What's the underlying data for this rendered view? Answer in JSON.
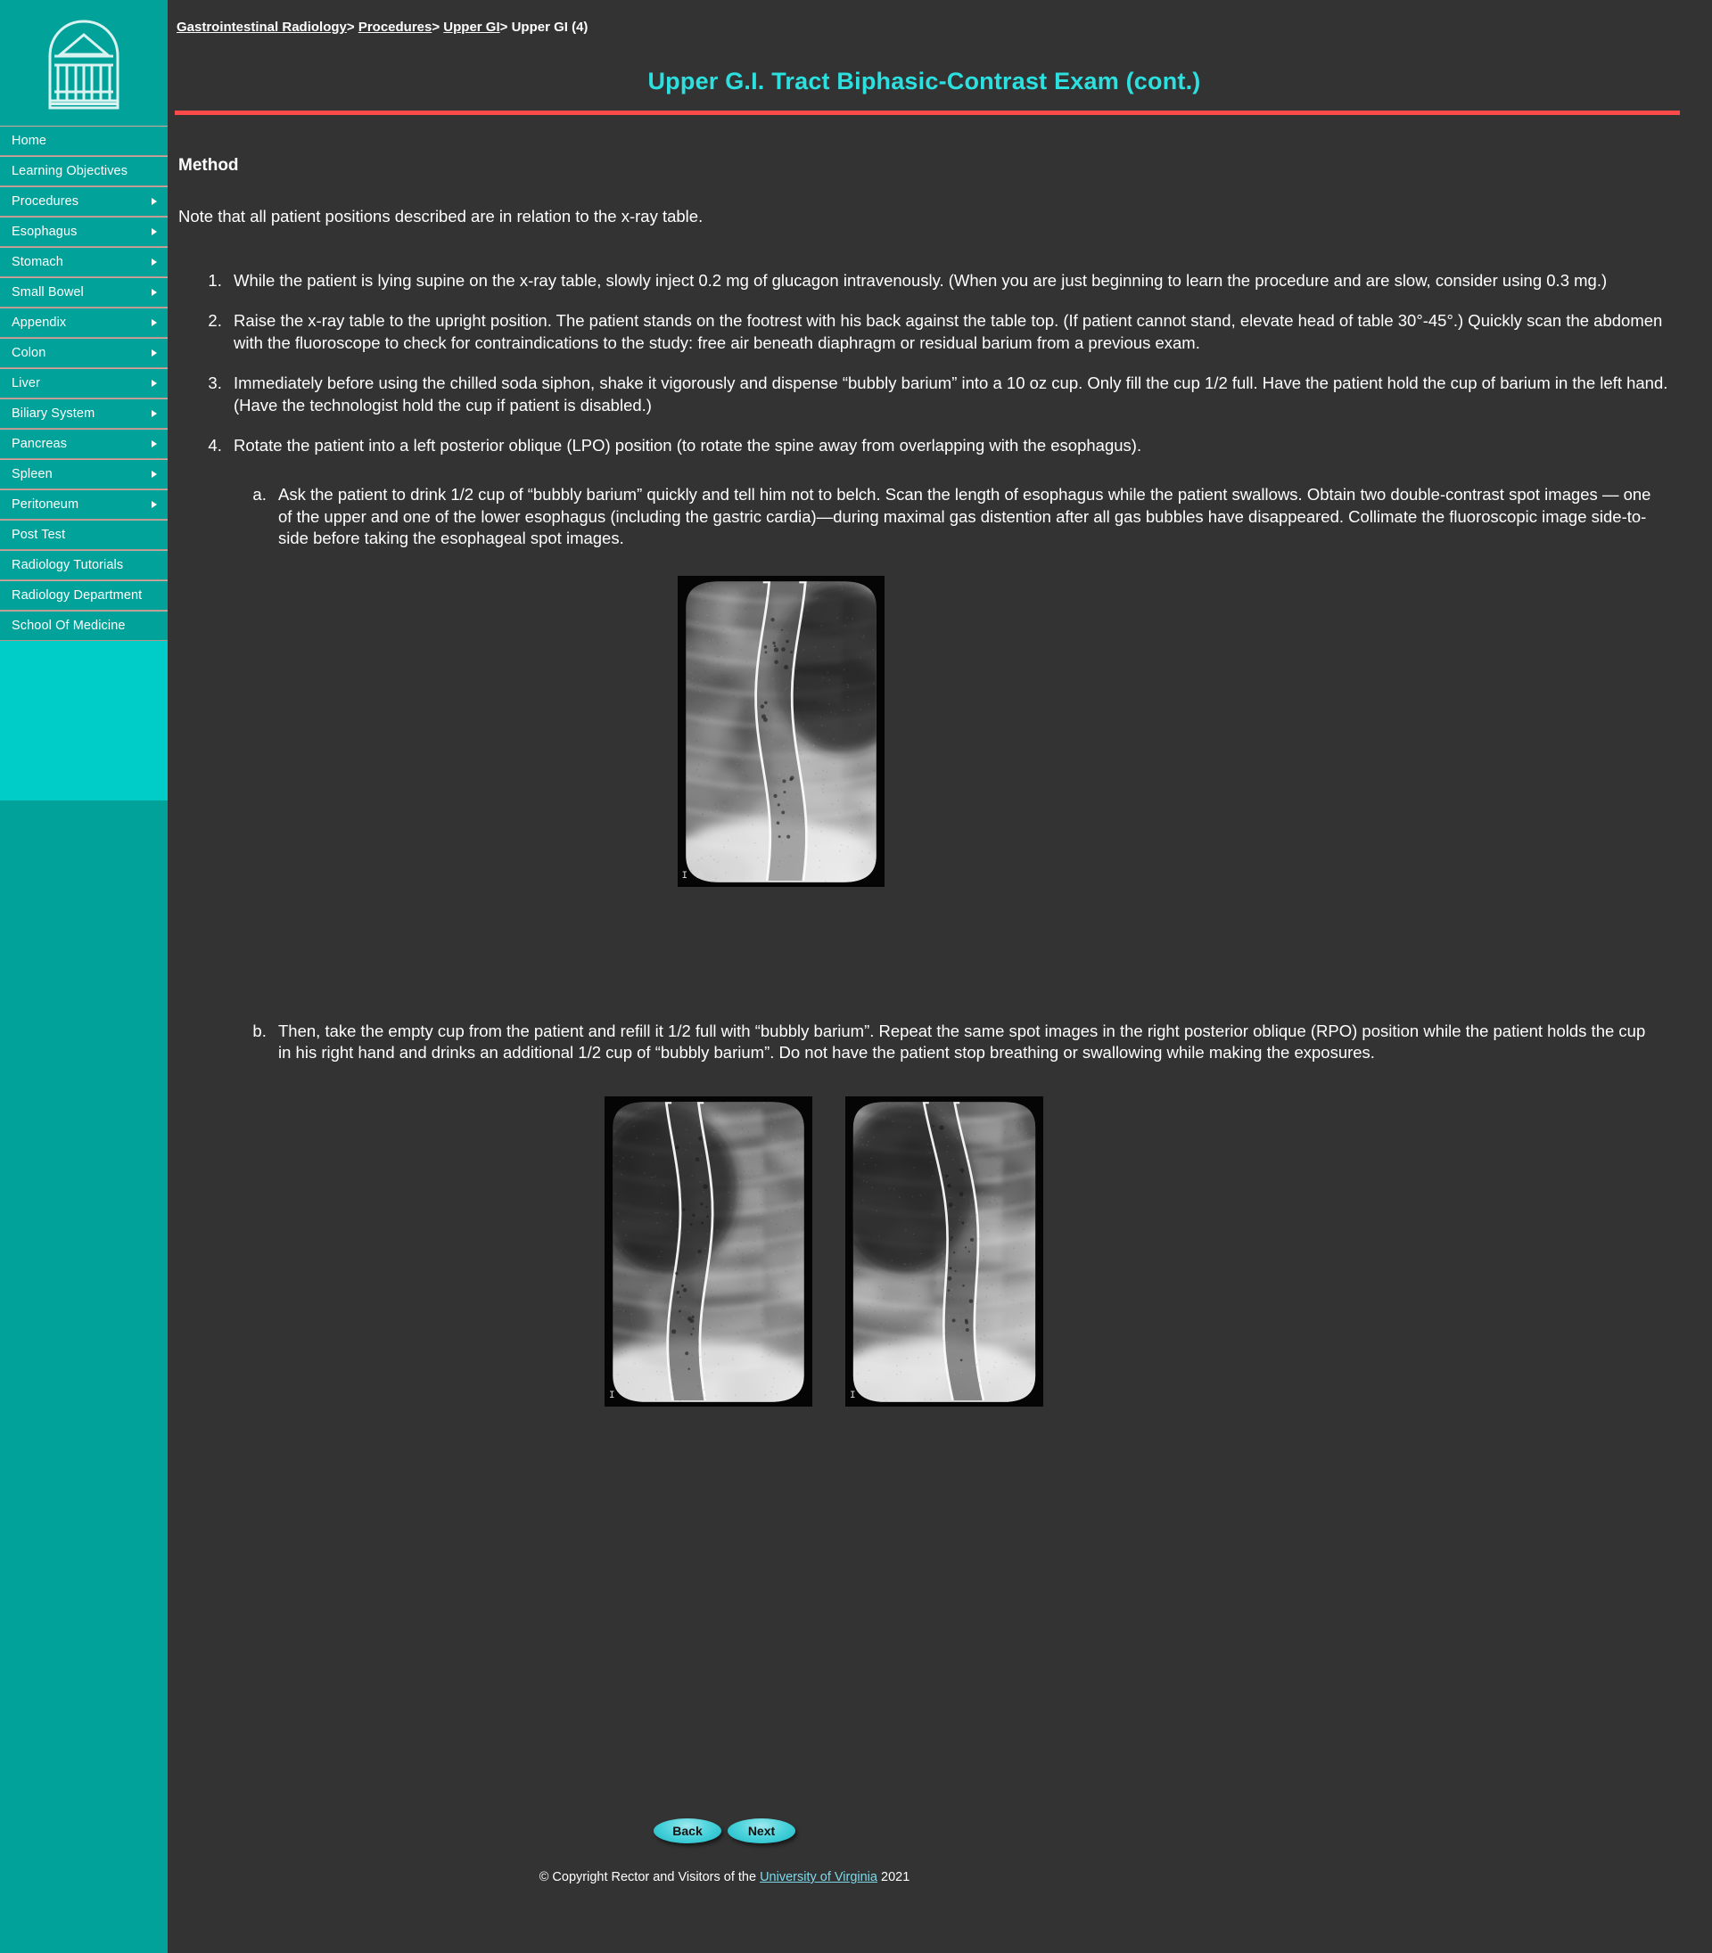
{
  "colors": {
    "sidebar_teal": "#00a29a",
    "sidebar_bright": "#00cdc8",
    "page_bg": "#333333",
    "title_cyan": "#2ce0e0",
    "rule_red": "#fb4a4a",
    "link_cyan": "#7fd8e8"
  },
  "logo": {
    "alt": "University of Virginia Rotunda logo"
  },
  "sidebar": {
    "items": [
      {
        "label": "Home",
        "arrow": false
      },
      {
        "label": "Learning Objectives",
        "arrow": false
      },
      {
        "label": "Procedures",
        "arrow": true
      },
      {
        "label": "Esophagus",
        "arrow": true
      },
      {
        "label": "Stomach",
        "arrow": true
      },
      {
        "label": "Small Bowel",
        "arrow": true
      },
      {
        "label": "Appendix",
        "arrow": true
      },
      {
        "label": "Colon",
        "arrow": true
      },
      {
        "label": "Liver",
        "arrow": true
      },
      {
        "label": "Biliary System",
        "arrow": true
      },
      {
        "label": "Pancreas",
        "arrow": true
      },
      {
        "label": "Spleen",
        "arrow": true
      },
      {
        "label": "Peritoneum",
        "arrow": true
      },
      {
        "label": "Post Test",
        "arrow": false
      },
      {
        "label": "Radiology Tutorials",
        "arrow": false
      },
      {
        "label": "Radiology Department",
        "arrow": false
      },
      {
        "label": "School Of Medicine",
        "arrow": false
      }
    ]
  },
  "breadcrumb": {
    "crumb1": "Gastrointestinal Radiology",
    "crumb2": "Procedures",
    "crumb3": "Upper GI",
    "current": "Upper GI (4)",
    "separator": ">"
  },
  "header": {
    "title": "Upper G.I. Tract Biphasic-Contrast Exam (cont.)"
  },
  "main": {
    "section_heading": "Method",
    "intro": "Note that all patient positions described are in relation to the x-ray table.",
    "steps": [
      "While the patient is lying supine on the x-ray table, slowly inject 0.2 mg of glucagon intravenously. (When you are just beginning to learn the procedure and are slow, consider using 0.3 mg.)",
      "Raise the x-ray table to the upright position. The patient stands on the footrest with his back against the table top. (If patient cannot stand, elevate head of table 30°-45°.) Quickly scan the abdomen with the fluoroscope to check for contraindications to the study: free air beneath diaphragm or residual barium from a previous exam.",
      "Immediately before using the chilled soda siphon, shake it vigorously and dispense “bubbly barium” into a 10 oz cup. Only fill the cup 1/2 full. Have the patient hold the cup of barium in the left hand. (Have the technologist hold the cup if patient is disabled.)",
      "Rotate the patient into a left posterior oblique (LPO) position (to rotate the spine away from overlapping with the esophagus)."
    ],
    "substeps": {
      "a": "Ask the patient to drink 1/2 cup of “bubbly barium” quickly and tell him not to belch. Scan the length of esophagus while the patient swallows. Obtain two double-contrast spot images — one of the upper and one of the lower esophagus (including the gastric cardia)—during maximal gas distention after all gas bubbles have disappeared. Collimate the fluoroscopic image side-to-side before taking the esophageal spot images.",
      "b": "Then, take the empty cup from the patient and refill it 1/2 full with “bubbly barium”. Repeat the same spot images in the right posterior oblique (RPO) position while the patient holds the cup in his right hand and drinks an additional 1/2 cup of “bubbly barium”. Do not have the patient stop breathing or swallowing while making the exposures."
    },
    "figures": [
      {
        "id": "lpo-esophagram",
        "caption_label": "I A",
        "alt": "Double-contrast spot image of esophagus, LPO position"
      },
      {
        "id": "rpo-esophagram-upper",
        "caption_label": "I A",
        "alt": "Double-contrast spot image of upper esophagus, RPO position"
      },
      {
        "id": "rpo-esophagram-lower",
        "caption_label": "I A",
        "alt": "Double-contrast spot image of lower esophagus, RPO position"
      }
    ]
  },
  "footer": {
    "back_label": "Back",
    "next_label": "Next",
    "copyright_prefix": "© Copyright Rector and Visitors of the",
    "copyright_link": "University of Virginia",
    "copyright_year": "2021"
  }
}
